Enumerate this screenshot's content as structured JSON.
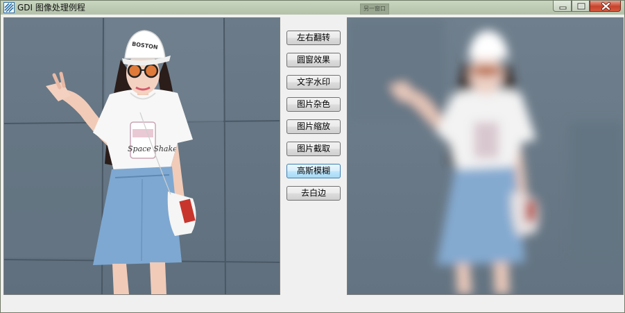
{
  "window": {
    "title": "GDI 图像处理例程",
    "background_chip": "另一窗口"
  },
  "buttons": [
    {
      "label": "左右翻转"
    },
    {
      "label": "圆窗效果"
    },
    {
      "label": "文字水印"
    },
    {
      "label": "图片杂色"
    },
    {
      "label": "图片缩放"
    },
    {
      "label": "图片截取"
    },
    {
      "label": "高斯模糊",
      "focused": true
    },
    {
      "label": "去白边"
    }
  ],
  "images": {
    "source": {
      "description_icon": "photo-icon",
      "cap_text": "BOSTON",
      "shirt_text": "Space Shake"
    },
    "result": {
      "effect": "gaussian-blur"
    }
  },
  "colors": {
    "wall": "#6f7f8d",
    "shirt": "#ffffff",
    "denim": "#7ea7cf",
    "focus_border": "#3c7fb1",
    "close_button": "#c7432b"
  }
}
